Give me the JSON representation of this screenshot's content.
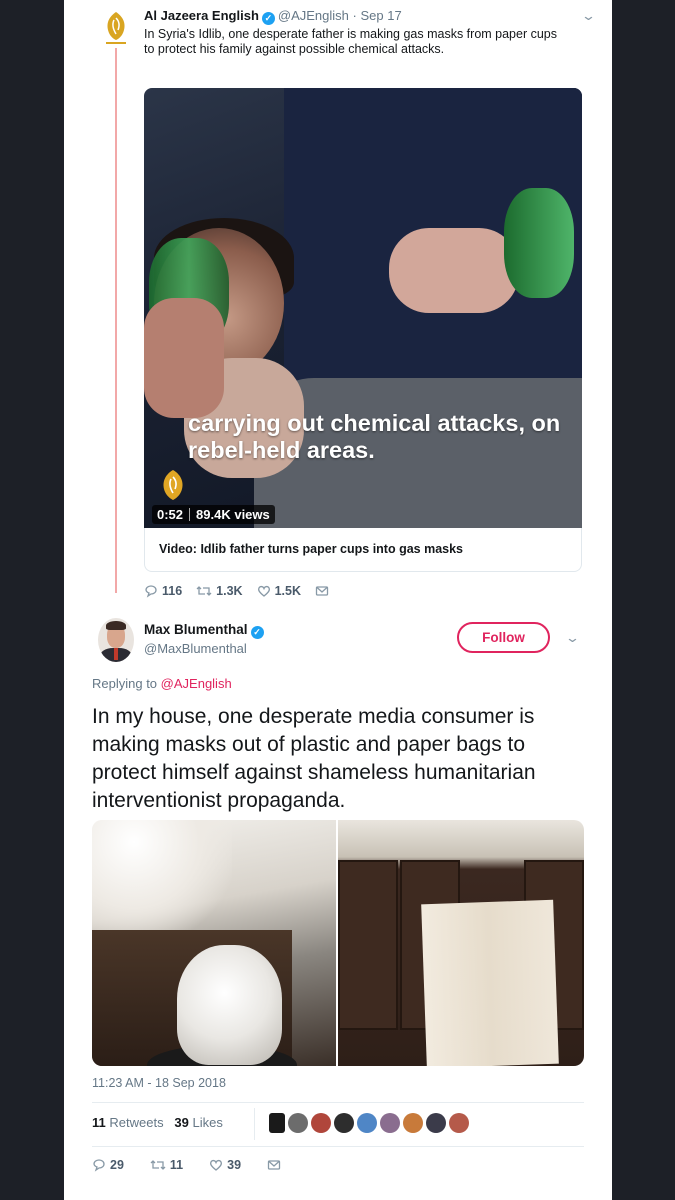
{
  "quoted_tweet": {
    "author_name": "Al Jazeera English",
    "handle": "@AJEnglish",
    "date": "Sep 17",
    "text": "In Syria's Idlib, one desperate father is making gas masks from paper cups to protect his family against possible chemical attacks.",
    "video": {
      "caption": "carrying out chemical attacks, on rebel-held areas.",
      "duration": "0:52",
      "views": "89.4K views",
      "card_title": "Video: Idlib father turns paper cups into gas masks"
    },
    "actions": {
      "replies": "116",
      "retweets": "1.3K",
      "likes": "1.5K"
    }
  },
  "main_tweet": {
    "author_name": "Max Blumenthal",
    "handle": "@MaxBlumenthal",
    "follow_label": "Follow",
    "replying_prefix": "Replying to",
    "replying_handle": "@AJEnglish",
    "text": "In my house, one desperate media consumer is making masks out of plastic and paper bags to protect himself against shameless humanitarian interventionist propaganda.",
    "timestamp": "11:23 AM - 18 Sep 2018",
    "stats": {
      "retweets": "11",
      "retweets_label": "Retweets",
      "likes": "39",
      "likes_label": "Likes"
    },
    "actions": {
      "replies": "29",
      "retweets": "11",
      "likes": "39"
    }
  },
  "icons": {
    "reply": "reply-icon",
    "retweet": "retweet-icon",
    "like": "heart-icon",
    "dm": "message-icon",
    "verified": "verified-badge-icon",
    "menu": "chevron-down-icon"
  },
  "colors": {
    "brand_blue": "#1da1f2",
    "follow_red": "#e0245e",
    "thread_line": "#f2a8a8",
    "muted": "#657786"
  }
}
